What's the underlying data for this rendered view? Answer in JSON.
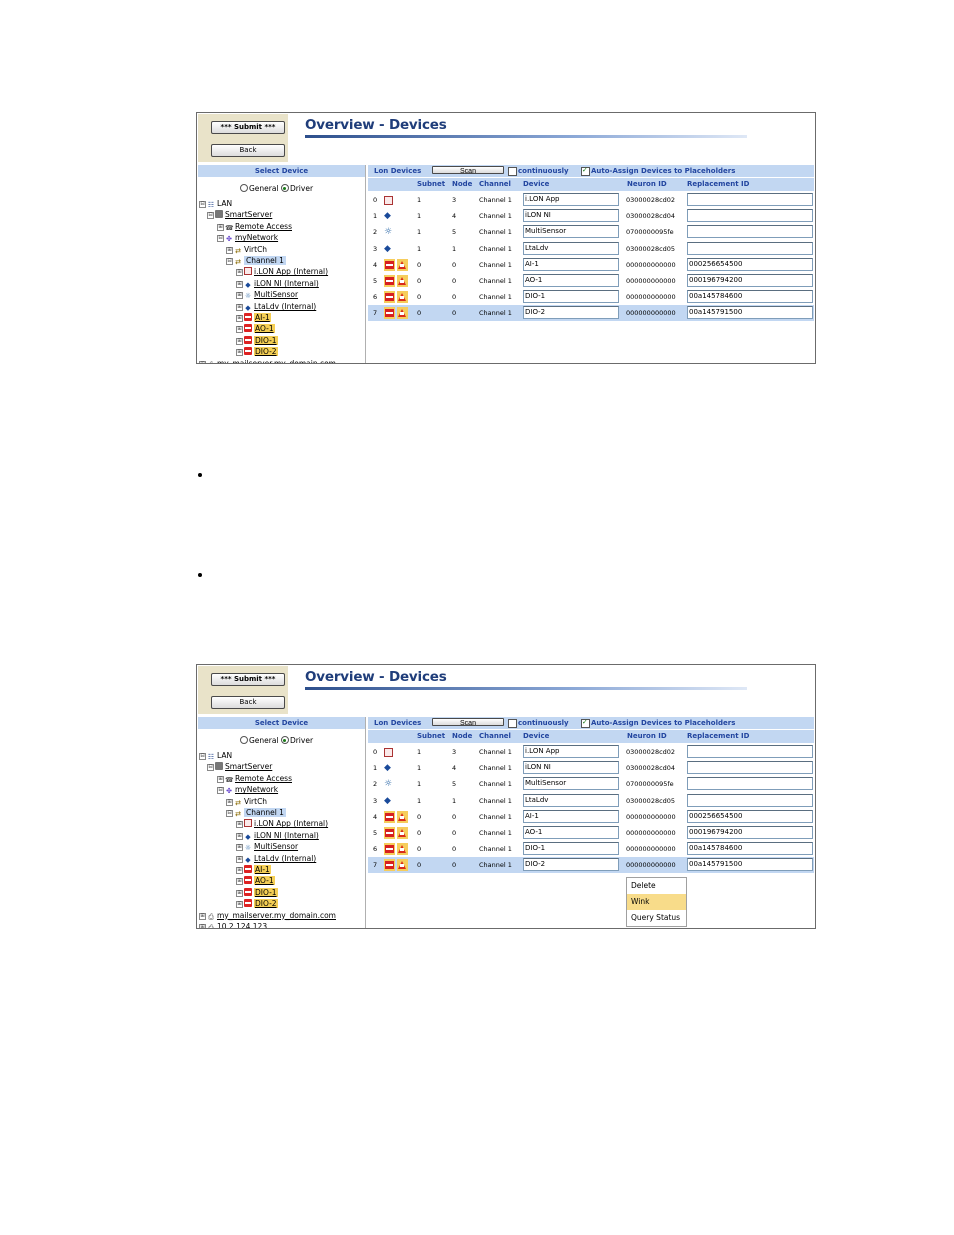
{
  "screenshots": [
    {
      "submit_label": "*** Submit ***",
      "back_label": "Back",
      "page_title": "Overview - Devices",
      "select_device_label": "Select Device",
      "radio_general": "General",
      "radio_driver": "Driver",
      "radio_selected": "Driver",
      "tree": [
        "LAN",
        "SmartServer",
        "Remote Access",
        "myNetwork",
        "VirtCh",
        "Channel 1",
        "i.LON App (Internal)",
        "iLON NI (Internal)",
        "MultiSensor",
        "LtaLdv (Internal)",
        "AI-1",
        "AO-1",
        "DIO-1",
        "DIO-2",
        "my_mailserver.my_domain.com"
      ],
      "lon_devices_label": "Lon Devices",
      "scan_label": "Scan",
      "continuously_label": "continuously",
      "continuously_checked": false,
      "auto_assign_label": "Auto-Assign Devices to Placeholders",
      "auto_assign_checked": true,
      "columns": [
        "Subnet",
        "Node",
        "Channel",
        "Device",
        "Neuron ID",
        "Replacement ID"
      ],
      "rows": [
        {
          "index": "0",
          "icon": "app-icon",
          "subnet": "1",
          "node": "3",
          "channel": "Channel 1",
          "device": "i.LON App",
          "neuron": "03000028cd02",
          "replacement": ""
        },
        {
          "index": "1",
          "icon": "network-interface-icon",
          "subnet": "1",
          "node": "4",
          "channel": "Channel 1",
          "device": "iLON NI",
          "neuron": "03000028cd04",
          "replacement": ""
        },
        {
          "index": "2",
          "icon": "sensor-icon",
          "subnet": "1",
          "node": "5",
          "channel": "Channel 1",
          "device": "MultiSensor",
          "neuron": "0700000095fe",
          "replacement": ""
        },
        {
          "index": "3",
          "icon": "network-interface-icon",
          "subnet": "1",
          "node": "1",
          "channel": "Channel 1",
          "device": "LtaLdv",
          "neuron": "03000028cd05",
          "replacement": ""
        },
        {
          "index": "4",
          "icon": "fb-warning",
          "subnet": "0",
          "node": "0",
          "channel": "Channel 1",
          "device": "AI-1",
          "neuron": "000000000000",
          "replacement": "000256654500"
        },
        {
          "index": "5",
          "icon": "fb-warning",
          "subnet": "0",
          "node": "0",
          "channel": "Channel 1",
          "device": "AO-1",
          "neuron": "000000000000",
          "replacement": "000196794200"
        },
        {
          "index": "6",
          "icon": "fb-warning",
          "subnet": "0",
          "node": "0",
          "channel": "Channel 1",
          "device": "DIO-1",
          "neuron": "000000000000",
          "replacement": "00a145784600"
        },
        {
          "index": "7",
          "icon": "fb-warning",
          "subnet": "0",
          "node": "0",
          "channel": "Channel 1",
          "device": "DIO-2",
          "neuron": "000000000000",
          "replacement": "00a145791500"
        }
      ]
    },
    {
      "submit_label": "*** Submit ***",
      "back_label": "Back",
      "page_title": "Overview - Devices",
      "select_device_label": "Select Device",
      "radio_general": "General",
      "radio_driver": "Driver",
      "radio_selected": "Driver",
      "tree": [
        "LAN",
        "SmartServer",
        "Remote Access",
        "myNetwork",
        "VirtCh",
        "Channel 1",
        "i.LON App (Internal)",
        "iLON NI (Internal)",
        "MultiSensor",
        "LtaLdv (Internal)",
        "AI-1",
        "AO-1",
        "DIO-1",
        "DIO-2",
        "my_mailserver.my_domain.com",
        "10.2.124.123"
      ],
      "lon_devices_label": "Lon Devices",
      "scan_label": "Scan",
      "continuously_label": "continuously",
      "continuously_checked": false,
      "auto_assign_label": "Auto-Assign Devices to Placeholders",
      "auto_assign_checked": true,
      "columns": [
        "Subnet",
        "Node",
        "Channel",
        "Device",
        "Neuron ID",
        "Replacement ID"
      ],
      "rows": [
        {
          "index": "0",
          "icon": "app-icon",
          "subnet": "1",
          "node": "3",
          "channel": "Channel 1",
          "device": "i.LON App",
          "neuron": "03000028cd02",
          "replacement": ""
        },
        {
          "index": "1",
          "icon": "network-interface-icon",
          "subnet": "1",
          "node": "4",
          "channel": "Channel 1",
          "device": "iLON NI",
          "neuron": "03000028cd04",
          "replacement": ""
        },
        {
          "index": "2",
          "icon": "sensor-icon",
          "subnet": "1",
          "node": "5",
          "channel": "Channel 1",
          "device": "MultiSensor",
          "neuron": "0700000095fe",
          "replacement": ""
        },
        {
          "index": "3",
          "icon": "network-interface-icon",
          "subnet": "1",
          "node": "1",
          "channel": "Channel 1",
          "device": "LtaLdv",
          "neuron": "03000028cd05",
          "replacement": ""
        },
        {
          "index": "4",
          "icon": "fb-warning",
          "subnet": "0",
          "node": "0",
          "channel": "Channel 1",
          "device": "AI-1",
          "neuron": "000000000000",
          "replacement": "000256654500"
        },
        {
          "index": "5",
          "icon": "fb-warning",
          "subnet": "0",
          "node": "0",
          "channel": "Channel 1",
          "device": "AO-1",
          "neuron": "000000000000",
          "replacement": "000196794200"
        },
        {
          "index": "6",
          "icon": "fb-warning",
          "subnet": "0",
          "node": "0",
          "channel": "Channel 1",
          "device": "DIO-1",
          "neuron": "000000000000",
          "replacement": "00a145784600"
        },
        {
          "index": "7",
          "icon": "fb-warning",
          "subnet": "0",
          "node": "0",
          "channel": "Channel 1",
          "device": "DIO-2",
          "neuron": "000000000000",
          "replacement": "00a145791500"
        }
      ],
      "context_menu": [
        "Delete",
        "Wink",
        "Query Status"
      ],
      "context_menu_highlighted": "Wink"
    }
  ],
  "colors": {
    "header_blue": "#c2d7f2",
    "title_navy": "#1f3d7a",
    "button_panel": "#e9e3c9",
    "fb_highlight": "#f5cf55",
    "menu_highlight": "#f8dc8a"
  }
}
